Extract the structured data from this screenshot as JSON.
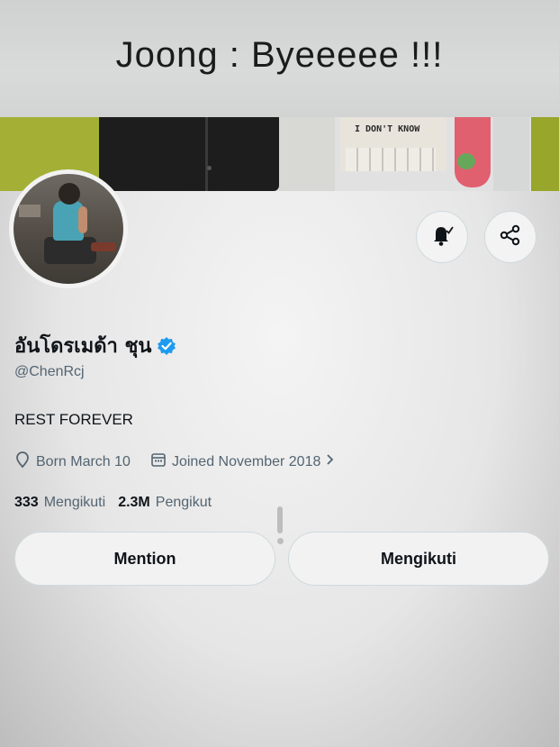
{
  "caption": {
    "text": "Joong : Byeeeee !!!"
  },
  "banner": {
    "sign_text": "I DON'T KNOW"
  },
  "profile": {
    "display_name": "อันโดรเมด้า ชุน",
    "handle": "@ChenRcj",
    "bio": "REST FOREVER",
    "verified": true,
    "born": "Born March 10",
    "joined": "Joined November 2018",
    "icons": {
      "notification": "bell-icon",
      "share": "share-icon",
      "birthday": "location-pin-icon",
      "joined": "calendar-icon",
      "verified": "verified-badge-icon"
    },
    "stats": {
      "following_count": "333",
      "following_label": "Mengikuti",
      "followers_count": "2.3M",
      "followers_label": "Pengikut"
    }
  },
  "actions": {
    "mention_label": "Mention",
    "follow_label": "Mengikuti"
  },
  "colors": {
    "verified": "#1d9bf0",
    "secondary_text": "#536471"
  }
}
